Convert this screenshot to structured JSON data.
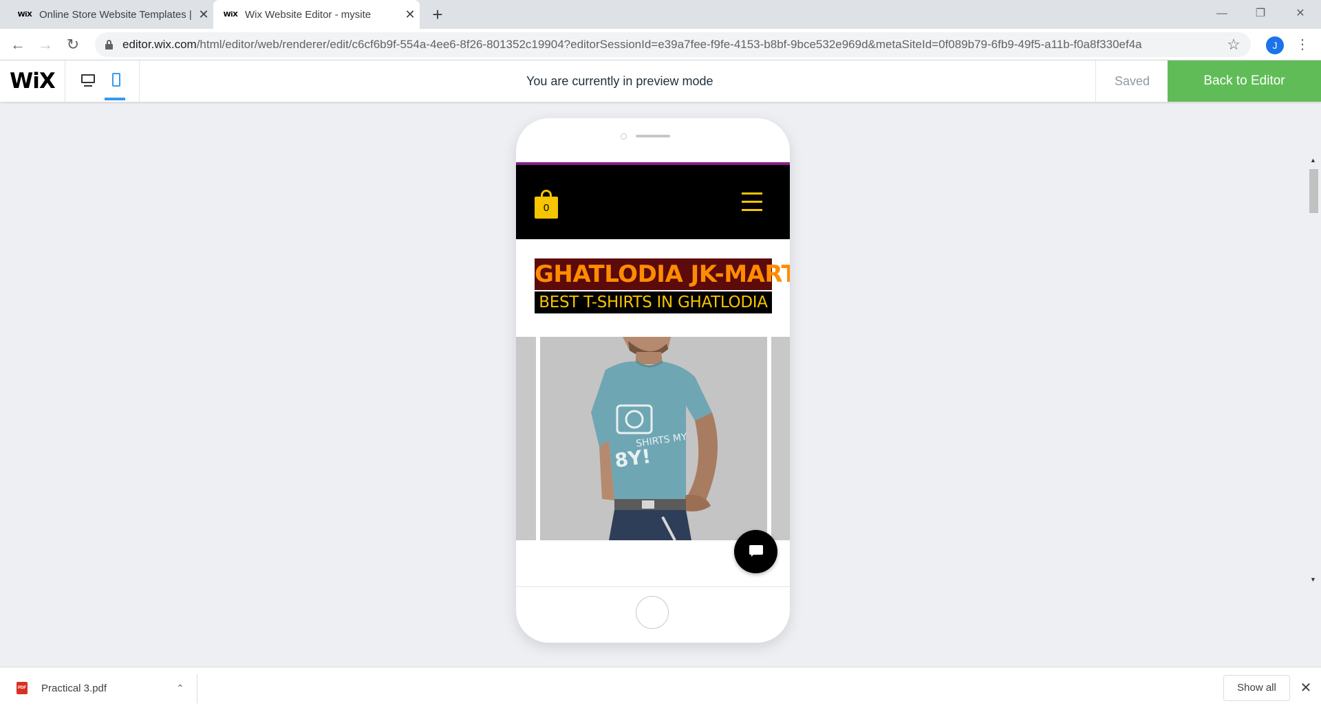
{
  "browser": {
    "tabs": [
      {
        "favicon": "WiX",
        "title": "Online Store Website Templates |",
        "active": false
      },
      {
        "favicon": "WiX",
        "title": "Wix Website Editor - mysite",
        "active": true
      }
    ],
    "url_domain": "editor.wix.com",
    "url_path": "/html/editor/web/renderer/edit/c6cf6b9f-554a-4ee6-8f26-801352c19904?editorSessionId=e39a7fee-f9fe-4153-b8bf-9bce532e969d&metaSiteId=0f089b79-6fb9-49f5-a11b-f0a8f330ef4a",
    "profile_initial": "J"
  },
  "wix_bar": {
    "logo": "WiX",
    "preview_message": "You are currently in preview mode",
    "saved_label": "Saved",
    "back_button": "Back to Editor",
    "active_device": "mobile",
    "accent_color": "#3899ec",
    "back_color": "#60bc57"
  },
  "site": {
    "cart_count": "0",
    "title": "GHATLODIA JK-MART",
    "subtitle": "BEST T-SHIRTS IN GHATLODIA",
    "title_bg": "#5c0a0a",
    "title_color": "#ff8c00",
    "subtitle_color": "#f6c400",
    "gallery_image": "man wearing light blue graphic t-shirt"
  },
  "downloads": {
    "file_name": "Practical 3.pdf",
    "file_badge": "PDF",
    "show_all": "Show all"
  }
}
